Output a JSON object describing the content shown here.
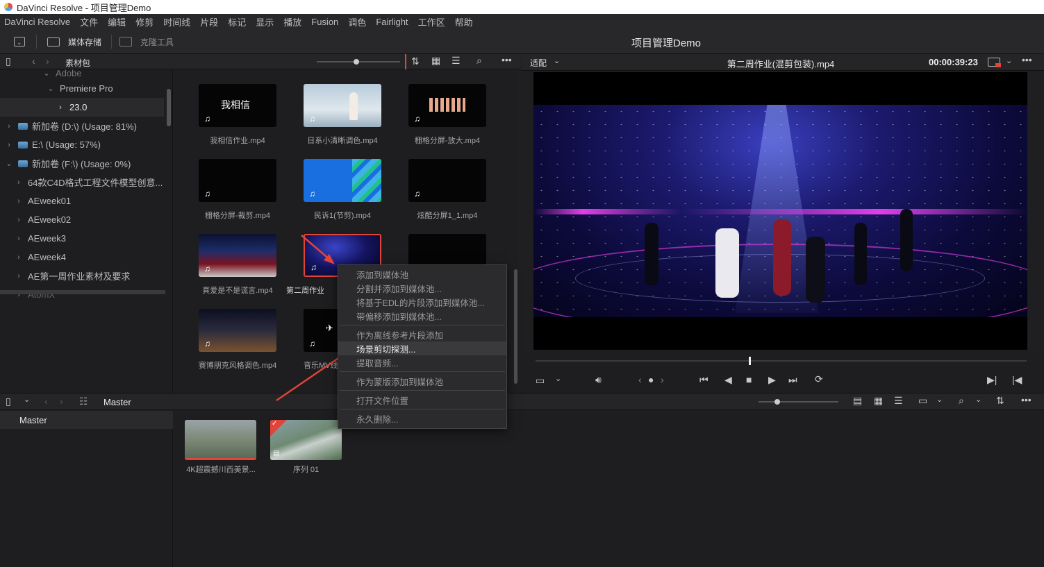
{
  "window": {
    "title": "DaVinci Resolve - 项目管理Demo"
  },
  "menu": [
    "DaVinci Resolve",
    "文件",
    "编辑",
    "修剪",
    "时间线",
    "片段",
    "标记",
    "显示",
    "播放",
    "Fusion",
    "调色",
    "Fairlight",
    "工作区",
    "帮助"
  ],
  "toolbar": {
    "media_storage": "媒体存储",
    "clone_tool": "克隆工具",
    "project_title": "项目管理Demo"
  },
  "media_pane": {
    "header": "素材包"
  },
  "tree": {
    "top_partial": "Adobe",
    "items": [
      "Premiere Pro",
      "23.0",
      "新加卷 (D:\\) (Usage: 81%)",
      "E:\\ (Usage: 57%)",
      "新加卷 (F:\\) (Usage: 0%)",
      "64款C4D格式工程文件模型创意...",
      "AEweek01",
      "AEweek02",
      "AEweek3",
      "AEweek4",
      "AE第一周作业素材及要求",
      "AtomX"
    ]
  },
  "clips": [
    {
      "label": "我相信作业.mp4",
      "thumb_text": "我相信"
    },
    {
      "label": "日系小清晰调色.mp4"
    },
    {
      "label": "栅格分屏-放大.mp4"
    },
    {
      "label": "栅格分屏-裁剪.mp4"
    },
    {
      "label": "民诉1(节剪).mp4"
    },
    {
      "label": "炫酷分屏1_1.mp4"
    },
    {
      "label": "真爱是不是谎言.mp4"
    },
    {
      "label": "第二周作业"
    },
    {
      "label": ""
    },
    {
      "label": "赛博朋克风格调色.mp4"
    },
    {
      "label": "音乐MV线"
    }
  ],
  "context_menu": {
    "items": [
      "添加到媒体池",
      "分割并添加到媒体池...",
      "将基于EDL的片段添加到媒体池...",
      "带偏移添加到媒体池...",
      "作为离线参考片段添加",
      "场景剪切探测...",
      "提取音频...",
      "作为蒙版添加到媒体池",
      "打开文件位置",
      "永久删除..."
    ],
    "highlighted": "场景剪切探测..."
  },
  "viewer": {
    "fit": "适配",
    "clip_name": "第二周作业(混剪包装).mp4",
    "timecode": "00:00:39:23"
  },
  "media_pool": {
    "bin_label": "Master",
    "bin_tree_item": "Master",
    "clips": [
      {
        "label": "4K超震撼川西美景..."
      },
      {
        "label": "序列 01"
      }
    ]
  },
  "colors": {
    "accent": "#e0443a",
    "menu_highlight": "#3a3a3c"
  }
}
